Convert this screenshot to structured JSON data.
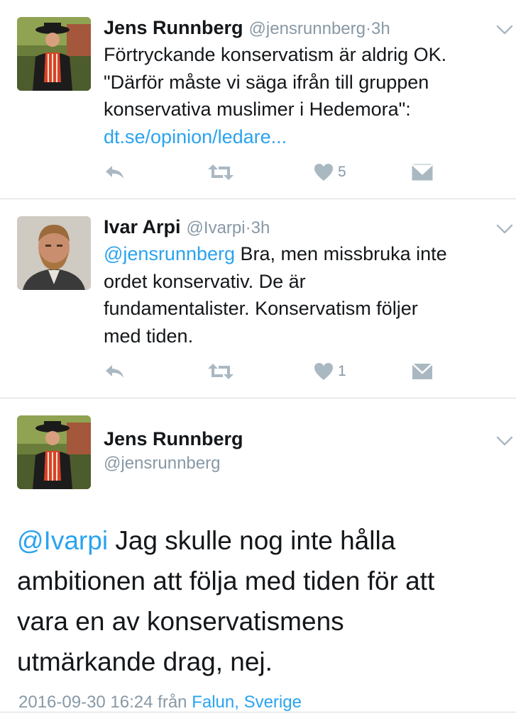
{
  "colors": {
    "link": "#2aa3ef",
    "secondary_text": "#8899a6",
    "action_icon": "#aab8c2",
    "divider": "#d6d9dc"
  },
  "tweets": [
    {
      "display_name": "Jens Runnberg",
      "handle": "@jensrunnberg",
      "separator": "·",
      "time": "3h",
      "text_lines": [
        "Förtryckande konservatism är aldrig OK.",
        "\"Därför måste vi säga ifrån till gruppen",
        "konservativa muslimer i Hedemora\":"
      ],
      "link": "dt.se/opinion/ledare...",
      "like_count": "5",
      "avatar_icon": "avatar-jens-runnberg"
    },
    {
      "display_name": "Ivar Arpi",
      "handle": "@Ivarpi",
      "separator": "·",
      "time": "3h",
      "mention": "@jensrunnberg",
      "text_first": " Bra, men missbruka inte",
      "text_lines": [
        "ordet konservativ. De är",
        "fundamentalister. Konservatism följer",
        "med tiden."
      ],
      "like_count": "1",
      "avatar_icon": "avatar-ivar-arpi"
    }
  ],
  "detail": {
    "display_name": "Jens Runnberg",
    "handle": "@jensrunnberg",
    "mention": "@Ivarpi",
    "text_first": " Jag skulle nog inte hålla",
    "text_lines": [
      "ambitionen att följa med tiden för att",
      "vara en av konservatismens",
      "utmärkande drag, nej."
    ],
    "timestamp": "2016-09-30 16:24",
    "from_label": "från",
    "place": "Falun, Sverige",
    "avatar_icon": "avatar-jens-runnberg"
  },
  "icons": {
    "reply": "reply-icon",
    "retweet": "retweet-icon",
    "like": "heart-icon",
    "dm": "direct-message-icon",
    "more": "chevron-down-icon"
  }
}
